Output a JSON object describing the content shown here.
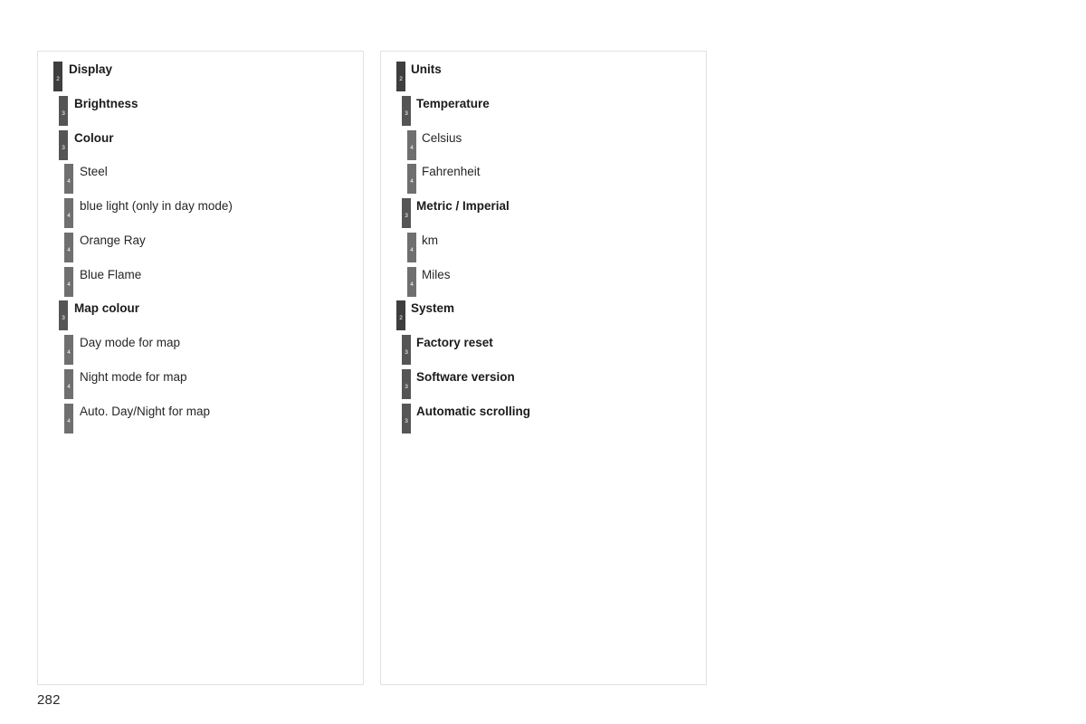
{
  "page": {
    "number": "282",
    "background": "#ffffff",
    "border_color": "#e2e2e2"
  },
  "level_colors": {
    "2": "#3e3e3e",
    "3": "#555555",
    "4": "#6f6f6f"
  },
  "columns": [
    {
      "name": "left",
      "entries": [
        {
          "level": "2",
          "label": "Display"
        },
        {
          "level": "3",
          "label": "Brightness"
        },
        {
          "level": "3",
          "label": "Colour"
        },
        {
          "level": "4",
          "label": "Steel"
        },
        {
          "level": "4",
          "label": "blue light (only in day mode)"
        },
        {
          "level": "4",
          "label": "Orange Ray"
        },
        {
          "level": "4",
          "label": "Blue Flame"
        },
        {
          "level": "3",
          "label": "Map colour"
        },
        {
          "level": "4",
          "label": "Day mode for map"
        },
        {
          "level": "4",
          "label": "Night mode for map"
        },
        {
          "level": "4",
          "label": "Auto. Day/Night for map"
        }
      ]
    },
    {
      "name": "right",
      "entries": [
        {
          "level": "2",
          "label": "Units"
        },
        {
          "level": "3",
          "label": "Temperature"
        },
        {
          "level": "4",
          "label": "Celsius"
        },
        {
          "level": "4",
          "label": "Fahrenheit"
        },
        {
          "level": "3",
          "label": "Metric / Imperial"
        },
        {
          "level": "4",
          "label": "km"
        },
        {
          "level": "4",
          "label": "Miles"
        },
        {
          "level": "2",
          "label": "System"
        },
        {
          "level": "3",
          "label": "Factory reset"
        },
        {
          "level": "3",
          "label": "Software version"
        },
        {
          "level": "3",
          "label": "Automatic scrolling"
        }
      ]
    }
  ]
}
